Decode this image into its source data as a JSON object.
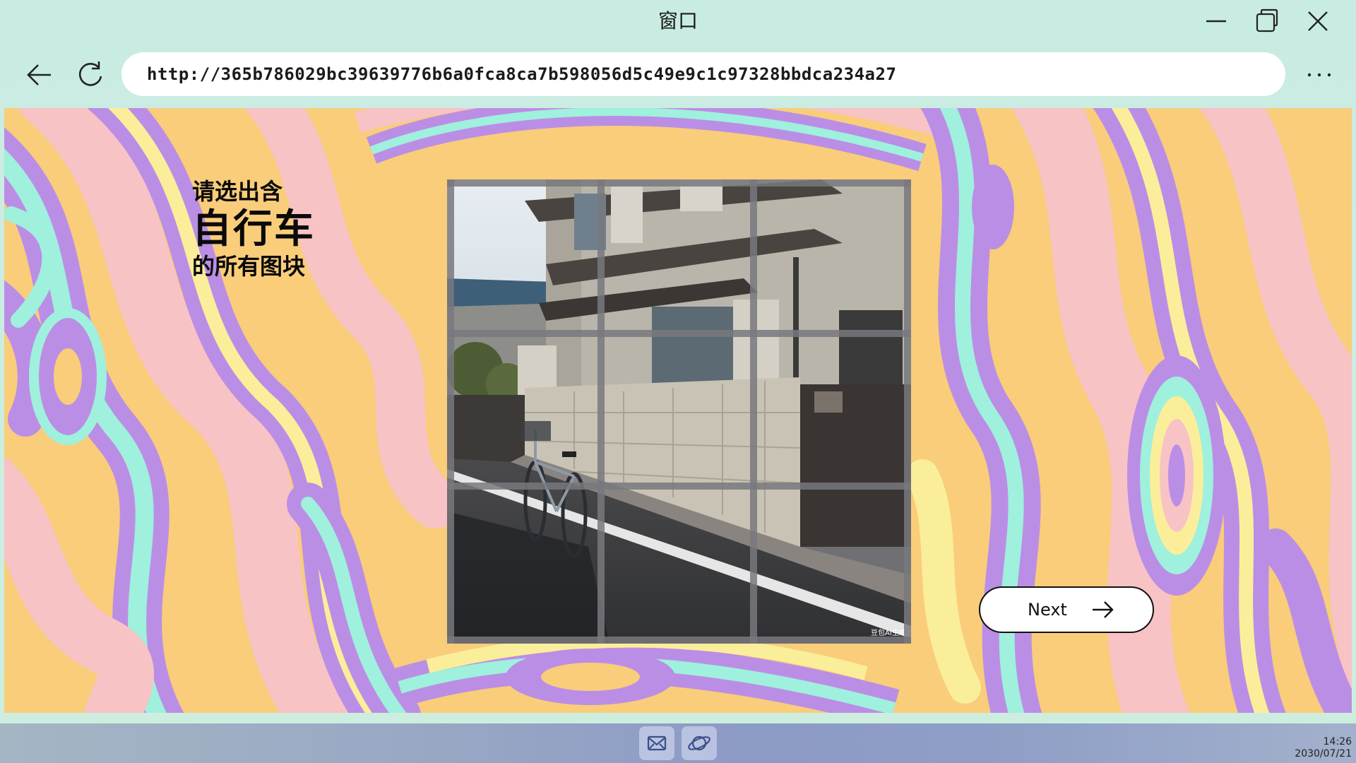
{
  "window": {
    "title": "窗口",
    "controls": {
      "minimize_icon": "minimize-icon",
      "maximize_icon": "restore-icon",
      "close_icon": "close-icon"
    }
  },
  "nav": {
    "back_icon": "arrow-left-icon",
    "reload_icon": "reload-icon",
    "url": "http://365b786029bc39639776b6a0fca8ca7b598056d5c49e9c1c97328bbdca234a27",
    "menu_icon": "more-horizontal-icon"
  },
  "captcha": {
    "prompt_line1": "请选出含",
    "prompt_target": "自行车",
    "prompt_line3": "的所有图块",
    "grid_rows": 3,
    "grid_cols": 3,
    "selected_tiles": [],
    "image_watermark": "豆包AI生成",
    "next_label": "Next",
    "next_icon": "arrow-right-icon"
  },
  "taskbar": {
    "apps": [
      {
        "name": "mail",
        "icon": "mail-icon"
      },
      {
        "name": "browser",
        "icon": "planet-icon"
      }
    ],
    "time": "14:26",
    "date": "2030/07/21"
  },
  "colors": {
    "background_yellow": "#f9cd7a",
    "background_pink": "#f7c3c5",
    "background_purple": "#bb8ee6",
    "background_mint": "#9ff0dc",
    "background_cream": "#fbee9a",
    "accent_text": "#0a0a0a"
  }
}
